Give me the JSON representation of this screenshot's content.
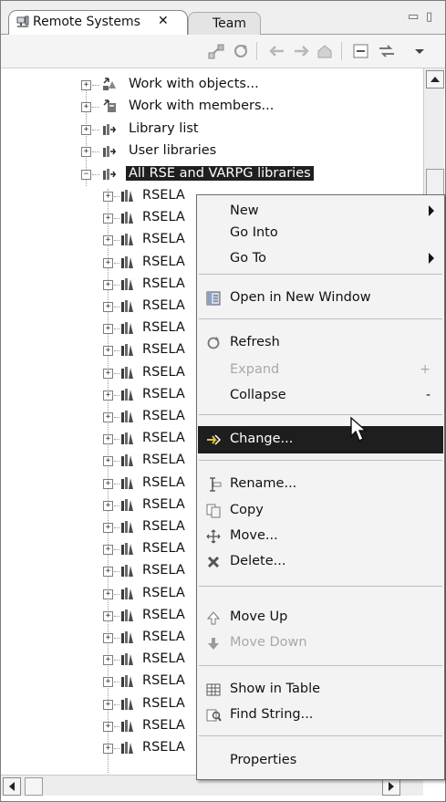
{
  "tabs": {
    "active_label": "Remote Systems",
    "active_close": "✕",
    "inactive_label": "Team"
  },
  "window_buttons": {
    "minimize": "▭",
    "maximize": "▯"
  },
  "toolbar": {
    "icons": [
      "connect-icon",
      "refresh-icon",
      "back-arrow-icon",
      "forward-arrow-icon",
      "home-icon",
      "collapse-all-icon",
      "link-with-editor-icon",
      "view-menu-icon"
    ]
  },
  "tree": {
    "top_items": [
      {
        "label": "Work with objects...",
        "icon": "work-objects-icon"
      },
      {
        "label": "Work with members...",
        "icon": "work-members-icon"
      },
      {
        "label": "Library list",
        "icon": "library-list-icon"
      },
      {
        "label": "User libraries",
        "icon": "user-libraries-icon"
      },
      {
        "label": "All RSE and VARPG libraries",
        "icon": "all-libraries-icon",
        "selected": true
      }
    ],
    "library_label": "RSELA",
    "library_rows": 26
  },
  "context_menu": {
    "items": [
      {
        "label": "New",
        "submenu": true
      },
      {
        "label": "Go Into"
      },
      {
        "label": "Go To",
        "submenu": true
      },
      {
        "label": "Open in New Window",
        "icon": "open-new-window-icon"
      },
      {
        "label": "Refresh",
        "icon": "refresh-icon"
      },
      {
        "label": "Expand",
        "shortcut": "+",
        "disabled": true
      },
      {
        "label": "Collapse",
        "shortcut": "-"
      },
      {
        "label": "Change...",
        "icon": "change-icon",
        "highlighted": true
      },
      {
        "label": "Rename...",
        "icon": "rename-icon"
      },
      {
        "label": "Copy",
        "icon": "copy-icon"
      },
      {
        "label": "Move...",
        "icon": "move-icon"
      },
      {
        "label": "Delete...",
        "icon": "delete-icon"
      },
      {
        "label": "Move Up",
        "icon": "move-up-icon"
      },
      {
        "label": "Move Down",
        "icon": "move-down-icon",
        "disabled": true
      },
      {
        "label": "Show in Table",
        "icon": "table-icon"
      },
      {
        "label": "Find String...",
        "icon": "find-string-icon"
      },
      {
        "label": "Properties"
      }
    ]
  },
  "colors": {
    "selection": "#1f1f1f",
    "menu_bg": "#f3f3f3",
    "disabled_text": "#a8a8a8"
  }
}
